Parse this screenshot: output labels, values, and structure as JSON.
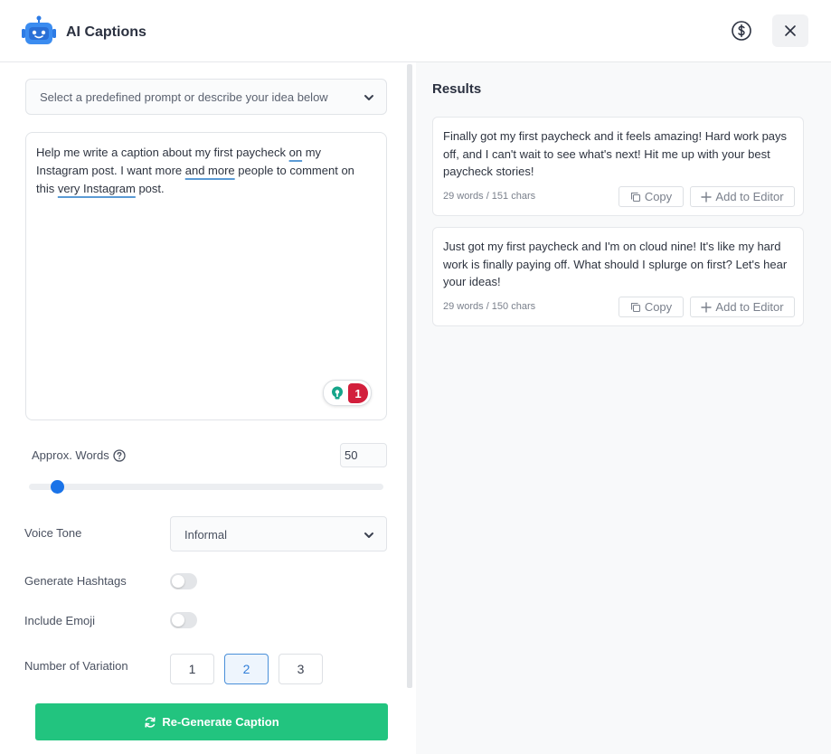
{
  "header": {
    "title": "AI Captions",
    "logo_icon": "robot-icon",
    "credits_icon": "dollar-circle-icon",
    "close_icon": "close-icon"
  },
  "form": {
    "prompt_select_placeholder": "Select a predefined prompt or describe your idea below",
    "prompt_segments": [
      "Help me write a caption about my first paycheck ",
      "on",
      " my Instagram post. I want more ",
      "and more",
      " people to comment on this ",
      "very Instagram",
      " post."
    ],
    "grammar_issue_count": "1",
    "approx_words_label": "Approx. Words",
    "approx_words_value": "50",
    "approx_words_slider_fraction": 0.08,
    "voice_tone_label": "Voice Tone",
    "voice_tone_value": "Informal",
    "hashtags_label": "Generate Hashtags",
    "hashtags_enabled": false,
    "emoji_label": "Include Emoji",
    "emoji_enabled": false,
    "variation_label": "Number of Variation",
    "variation_options": [
      "1",
      "2",
      "3"
    ],
    "variation_selected": "2",
    "regenerate_label": "Re-Generate Caption"
  },
  "results": {
    "title": "Results",
    "copy_label": "Copy",
    "add_label": "Add to Editor",
    "items": [
      {
        "text": "Finally got my first paycheck and it feels amazing! Hard work pays off, and I can't wait to see what's next! Hit me up with your best paycheck stories!",
        "meta": "29 words / 151 chars"
      },
      {
        "text": "Just got my first paycheck and I'm on cloud nine! It's like my hard work is finally paying off. What should I splurge on first? Let's hear your ideas!",
        "meta": "29 words / 150 chars"
      }
    ]
  },
  "colors": {
    "accent": "#1a73e8",
    "primary_button": "#22c47f",
    "grammar_badge": "#d21f3c",
    "grammar_bulb": "#15a58a"
  }
}
